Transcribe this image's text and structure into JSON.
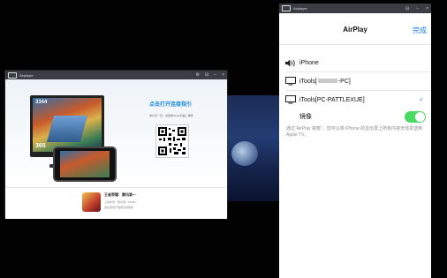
{
  "left_window": {
    "title": "Airplayer",
    "controls": [
      "⚙",
      "⊟",
      "−",
      "×"
    ],
    "game_hud": {
      "top": "3344",
      "bottom": "365"
    },
    "connect_guide": "点击打开连接指引",
    "scan_hint": "用户扫一扫，请使用iTools扫描二维码",
    "promo": {
      "title": "王者荣耀：腾讯第一",
      "line1": "上线时间：腾讯第一MOBA",
      "line2": "适合游戏开发者互动使用"
    }
  },
  "panel": {
    "title": "Airplayer",
    "controls": [
      "⊟",
      "−",
      "×"
    ],
    "nav": {
      "title": "AirPlay",
      "done": "完成"
    },
    "devices": [
      {
        "name": "iPhone",
        "icon": "speaker-icon",
        "selected": false
      },
      {
        "name_prefix": "iTools[",
        "name_suffix": "-PC]",
        "icon": "monitor-icon",
        "selected": false
      },
      {
        "name": "iTools[PC-PATTLEXUE]",
        "icon": "monitor-icon",
        "selected": true
      }
    ],
    "mirroring": {
      "label": "镜像",
      "on": true
    },
    "note": "通过\"AirPlay 镜像\"，您可以将 iPhone 的显示屏上所有内容无线发送到 Apple TV。",
    "checkmark": "✓",
    "colors": {
      "accent": "#1a7ef2",
      "toggle": "#4cd964"
    }
  }
}
